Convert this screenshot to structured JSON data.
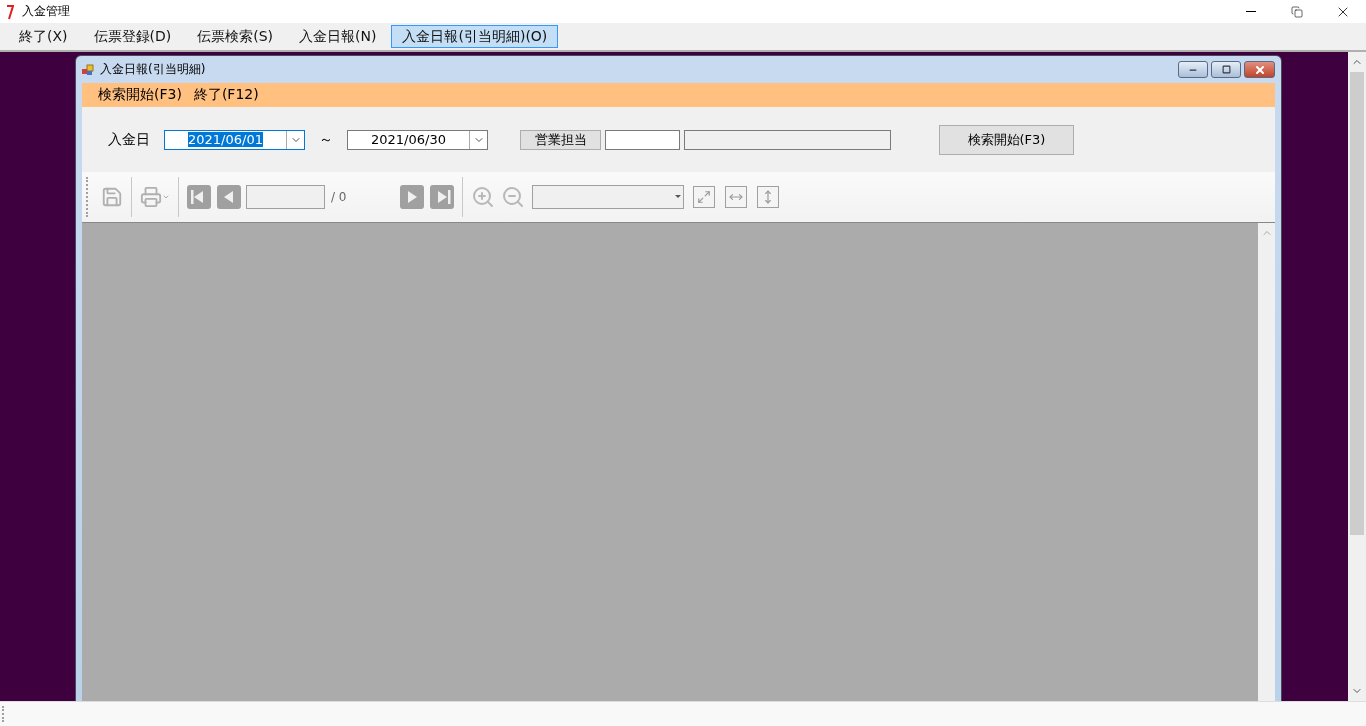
{
  "window": {
    "title": "入金管理"
  },
  "menu": [
    {
      "label": "終了(X)",
      "selected": false
    },
    {
      "label": "伝票登録(D)",
      "selected": false
    },
    {
      "label": "伝票検索(S)",
      "selected": false
    },
    {
      "label": "入金日報(N)",
      "selected": false
    },
    {
      "label": "入金日報(引当明細)(O)",
      "selected": true
    }
  ],
  "child_window": {
    "title": "入金日報(引当明細)",
    "menu": [
      {
        "label": "検索開始(F3)"
      },
      {
        "label": "終了(F12)"
      }
    ],
    "form": {
      "date_label": "入金日",
      "date_from": {
        "value": "2021/06/01",
        "focused": true
      },
      "separator": "～",
      "date_to": {
        "value": "2021/06/30",
        "focused": false
      },
      "staff_button": "営業担当",
      "search_button": "検索開始(F3)"
    },
    "toolbar": {
      "page_total": "/ 0"
    }
  }
}
